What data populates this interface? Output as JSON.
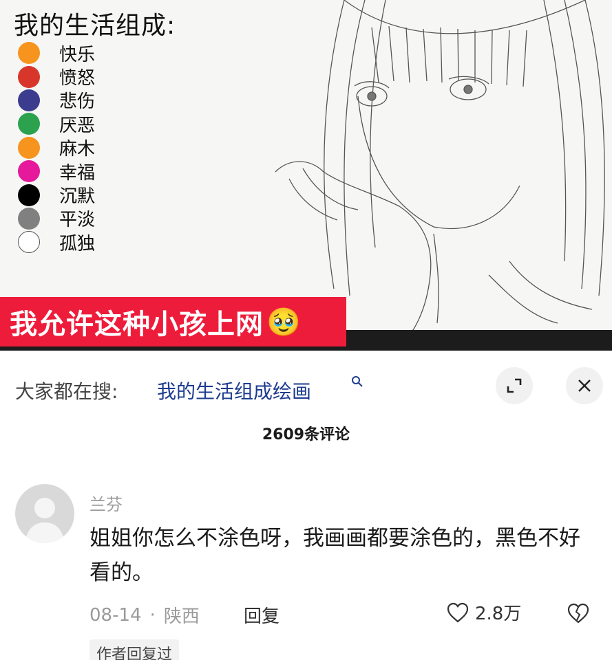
{
  "artwork": {
    "title": "我的生活组成:",
    "legend": [
      {
        "label": "快乐",
        "color": "#f7941d"
      },
      {
        "label": "愤怒",
        "color": "#d9362b"
      },
      {
        "label": "悲伤",
        "color": "#3b3c8e"
      },
      {
        "label": "厌恶",
        "color": "#2ca24f"
      },
      {
        "label": "麻木",
        "color": "#f7941d"
      },
      {
        "label": "幸福",
        "color": "#e6189b"
      },
      {
        "label": "沉默",
        "color": "#000000"
      },
      {
        "label": "平淡",
        "color": "#808080"
      },
      {
        "label": "孤独",
        "color": "#ffffff"
      }
    ],
    "overlay_text": "我允许这种小孩上网",
    "overlay_emoji": "🥹"
  },
  "search": {
    "prefix": "大家都在搜:",
    "query": "我的生活组成绘画",
    "search_icon": "search-icon",
    "expand_icon": "expand-icon",
    "close_icon": "close-icon"
  },
  "comments_header": {
    "count_text": "2609条评论"
  },
  "comment": {
    "username": "兰芬",
    "text": "姐姐你怎么不涂色呀，我画画都要涂色的，黑色不好看的。",
    "date": "08-14",
    "separator": "·",
    "location": "陕西",
    "reply_label": "回复",
    "like_count": "2.8万",
    "author_replied": "作者回复过"
  },
  "colors": {
    "banner_red": "#ee1c3b",
    "link_blue": "#1d3c8f",
    "meta_gray": "#9a9a9a"
  }
}
